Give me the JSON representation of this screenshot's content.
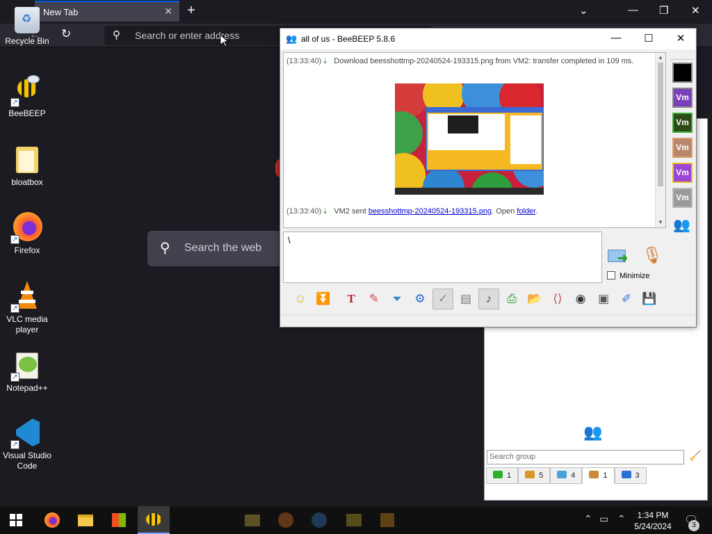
{
  "browser": {
    "tab_title": "New Tab",
    "url_placeholder": "Search or enter address",
    "search_placeholder": "Search the web"
  },
  "desktop_icons": [
    {
      "label": "Recycle Bin",
      "icon": "recycle-bin-icon"
    },
    {
      "label": "BeeBEEP",
      "icon": "beebeep-icon"
    },
    {
      "label": "bloatbox",
      "icon": "folder-icon"
    },
    {
      "label": "Firefox",
      "icon": "firefox-icon"
    },
    {
      "label": "VLC media player",
      "icon": "vlc-icon"
    },
    {
      "label": "Notepad++",
      "icon": "notepadpp-icon"
    },
    {
      "label": "Visual Studio Code",
      "icon": "vscode-icon"
    }
  ],
  "beebeep": {
    "title": "all of us - BeeBEEP 5.8.6",
    "messages": {
      "first": {
        "time": "(13:33:40)",
        "text": "Download beesshottmp-20240524-193315.png from VM2: transfer completed in 109 ms."
      },
      "second": {
        "time": "(13:33:40)",
        "prefix": "VM2 sent",
        "file_link": "beesshottmp-20240524-193315.png",
        "middle": ". Open",
        "folder_link": "folder",
        "suffix": "."
      }
    },
    "input_value": "\\",
    "minimize_label": "Minimize",
    "vm_labels": [
      "Vm",
      "Vm",
      "Vm",
      "Vm",
      "Vm"
    ],
    "vm_colors": [
      "#8a3ccf",
      "#2e4a16",
      "#b8866a",
      "#9a45d6",
      "#9a9a9a"
    ]
  },
  "group_panel": {
    "search_placeholder": "Search group",
    "tabs": [
      {
        "count": "1",
        "icon": "chat-green-icon"
      },
      {
        "count": "5",
        "icon": "users-icon"
      },
      {
        "count": "4",
        "icon": "chats-icon"
      },
      {
        "count": "1",
        "icon": "group-icon"
      },
      {
        "count": "3",
        "icon": "network-icon"
      }
    ]
  },
  "taskbar": {
    "time": "1:34 PM",
    "date": "5/24/2024",
    "notifications": "3"
  }
}
